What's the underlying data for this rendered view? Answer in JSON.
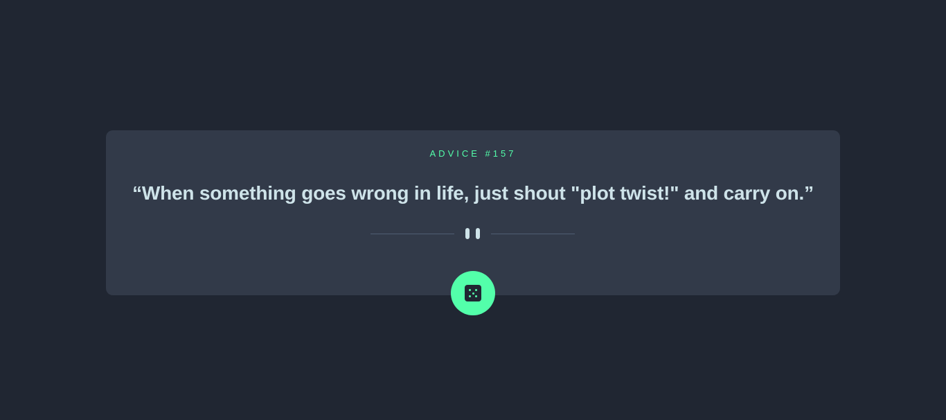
{
  "advice": {
    "label_prefix": "ADVICE #",
    "number": "157",
    "quote": "“When something goes wrong in life, just shout \"plot twist!\" and carry on.”"
  },
  "icons": {
    "divider": "pause-icon",
    "button": "dice-icon"
  },
  "colors": {
    "background": "#202632",
    "card": "#323a49",
    "accent": "#53ffaa",
    "text": "#cee3e9",
    "divider_line": "#4f5d74"
  }
}
